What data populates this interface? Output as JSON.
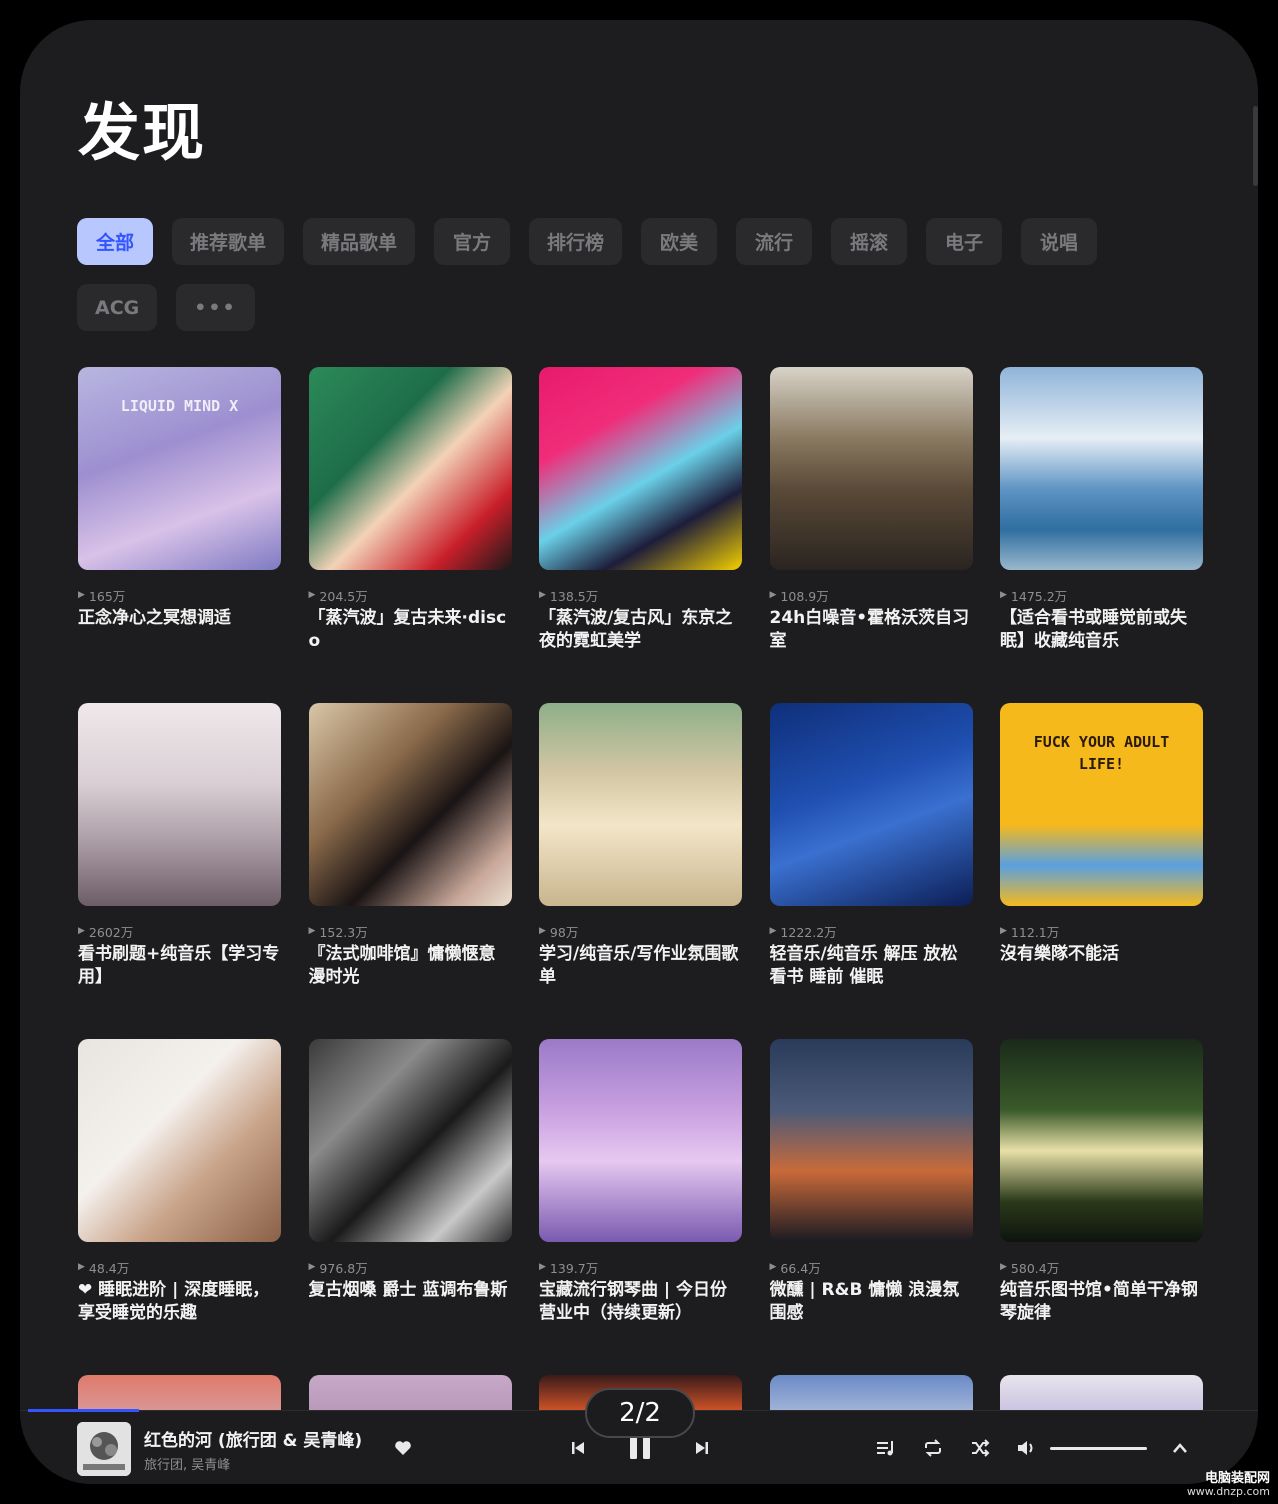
{
  "page": {
    "title": "发现"
  },
  "chips": [
    {
      "label": "全部",
      "active": true
    },
    {
      "label": "推荐歌单"
    },
    {
      "label": "精品歌单"
    },
    {
      "label": "官方"
    },
    {
      "label": "排行榜"
    },
    {
      "label": "欧美"
    },
    {
      "label": "流行"
    },
    {
      "label": "摇滚"
    },
    {
      "label": "电子"
    },
    {
      "label": "说唱"
    },
    {
      "label": "ACG"
    },
    {
      "label": "•••",
      "more": true
    }
  ],
  "playlists": [
    {
      "plays": "165万",
      "title": "正念净心之冥想调适",
      "cover": "linear-gradient(160deg,#b8b6e0 0%,#9d8fd0 40%,#d9c2e8 70%,#7e7ac2 100%)",
      "cover_text": "LIQUID MIND X"
    },
    {
      "plays": "204.5万",
      "title": "「蒸汽波」复古未来·disco",
      "cover": "linear-gradient(135deg,#2c8a58 0%,#1e6d4a 35%,#f2d3b8 55%,#c91f2a 80%,#1a1a1a 100%)"
    },
    {
      "plays": "138.5万",
      "title": "「蒸汽波/复古风」东京之夜的霓虹美学",
      "cover": "linear-gradient(150deg,#e81a6b 0%,#f02d7a 30%,#6ad0e8 55%,#1d1d3a 75%,#f5d000 100%)"
    },
    {
      "plays": "108.9万",
      "title": "24h白噪音•霍格沃茨自习室",
      "cover": "linear-gradient(180deg,#d8d3c8 0%,#8a7a62 35%,#5a4a38 60%,#2a2420 100%)"
    },
    {
      "plays": "1475.2万",
      "title": "【适合看书或睡觉前或失眠】收藏纯音乐",
      "cover": "linear-gradient(180deg,#8fb4d9 0%,#e7eef5 35%,#5e95c4 60%,#2f6ea0 80%,#9ab8cc 100%)"
    },
    {
      "plays": "2602万",
      "title": "看书刷题+纯音乐【学习专用】",
      "cover": "linear-gradient(180deg,#efe8ea 0%,#d9ced4 40%,#a89aa2 70%,#6c5d66 100%)"
    },
    {
      "plays": "152.3万",
      "title": "『法式咖啡馆』慵懒惬意漫时光",
      "cover": "linear-gradient(135deg,#d9c7a8 0%,#8a6a4a 35%,#1a1414 60%,#c9a89a 85%,#eae0d0 100%)"
    },
    {
      "plays": "98万",
      "title": "学习/纯音乐/写作业氛围歌单",
      "cover": "linear-gradient(180deg,#8fae8a 0%,#d4c7a4 35%,#f3e6c8 60%,#c9b58e 100%)"
    },
    {
      "plays": "1222.2万",
      "title": "轻音乐/纯音乐 解压 放松 看书 睡前 催眠",
      "cover": "linear-gradient(160deg,#0f2f7a 0%,#1f4fb0 40%,#3a70d0 60%,#0c1e55 100%)"
    },
    {
      "plays": "112.1万",
      "title": "沒有樂隊不能活",
      "cover": "linear-gradient(180deg,#f6b91c 0%,#f6b91c 60%,#5aa0e0 80%,#f6b91c 100%)",
      "cover_text": "FUCK YOUR ADULT LIFE!"
    },
    {
      "plays": "48.4万",
      "title": "❤ 睡眠进阶 | 深度睡眠，享受睡觉的乐趣",
      "cover": "linear-gradient(135deg,#e8e4e0 0%,#f4f0ec 40%,#c9a48a 65%,#8a6048 100%)"
    },
    {
      "plays": "976.8万",
      "title": "复古烟嗓 爵士 蓝调布鲁斯",
      "cover": "linear-gradient(135deg,#3a3a3a 0%,#8a8a8a 30%,#1a1a1a 55%,#c8c8c8 80%,#2a2a2a 100%)"
    },
    {
      "plays": "139.7万",
      "title": "宝藏流行钢琴曲 | 今日份营业中（持续更新）",
      "cover": "linear-gradient(180deg,#9a7ac8 0%,#c9a0e0 35%,#e6c8f0 60%,#7a5ab0 100%)"
    },
    {
      "plays": "66.4万",
      "title": "微醺 | R&B 慵懒 浪漫氛围感",
      "cover": "linear-gradient(180deg,#2a3a5a 0%,#4a5a78 35%,#c86a3a 65%,#1a1a22 100%)"
    },
    {
      "plays": "580.4万",
      "title": "纯音乐图书馆•简单干净钢琴旋律",
      "cover": "linear-gradient(180deg,#1a2a1a 0%,#3a5a2a 35%,#e8e0a8 55%,#2a3a1a 80%,#0e140e 100%)"
    }
  ],
  "partial_covers": [
    "linear-gradient(180deg,#e07a6a 0%,#d89a9a 100%)",
    "linear-gradient(180deg,#c8a8c8 0%,#b898b8 100%)",
    "linear-gradient(180deg,#3a1a1a 0%,#e05a2a 100%)",
    "linear-gradient(180deg,#6a8ac8 0%,#a8b8d8 100%)",
    "linear-gradient(180deg,#e8e4ec 0%,#c8c0e0 100%)"
  ],
  "player": {
    "song_title": "红色的河 (旅行团 & 吴青峰)",
    "artist": "旅行团, 吴青峰",
    "progress": 0.09,
    "volume": 1.0
  },
  "pager": {
    "label": "2/2"
  },
  "watermark": {
    "line1": "电脑装配网",
    "line2": "www.dnzp.com"
  },
  "colors": {
    "accent": "#3355ff",
    "chip_active_bg": "#b9c7ff",
    "bg": "#1d1d1f"
  }
}
